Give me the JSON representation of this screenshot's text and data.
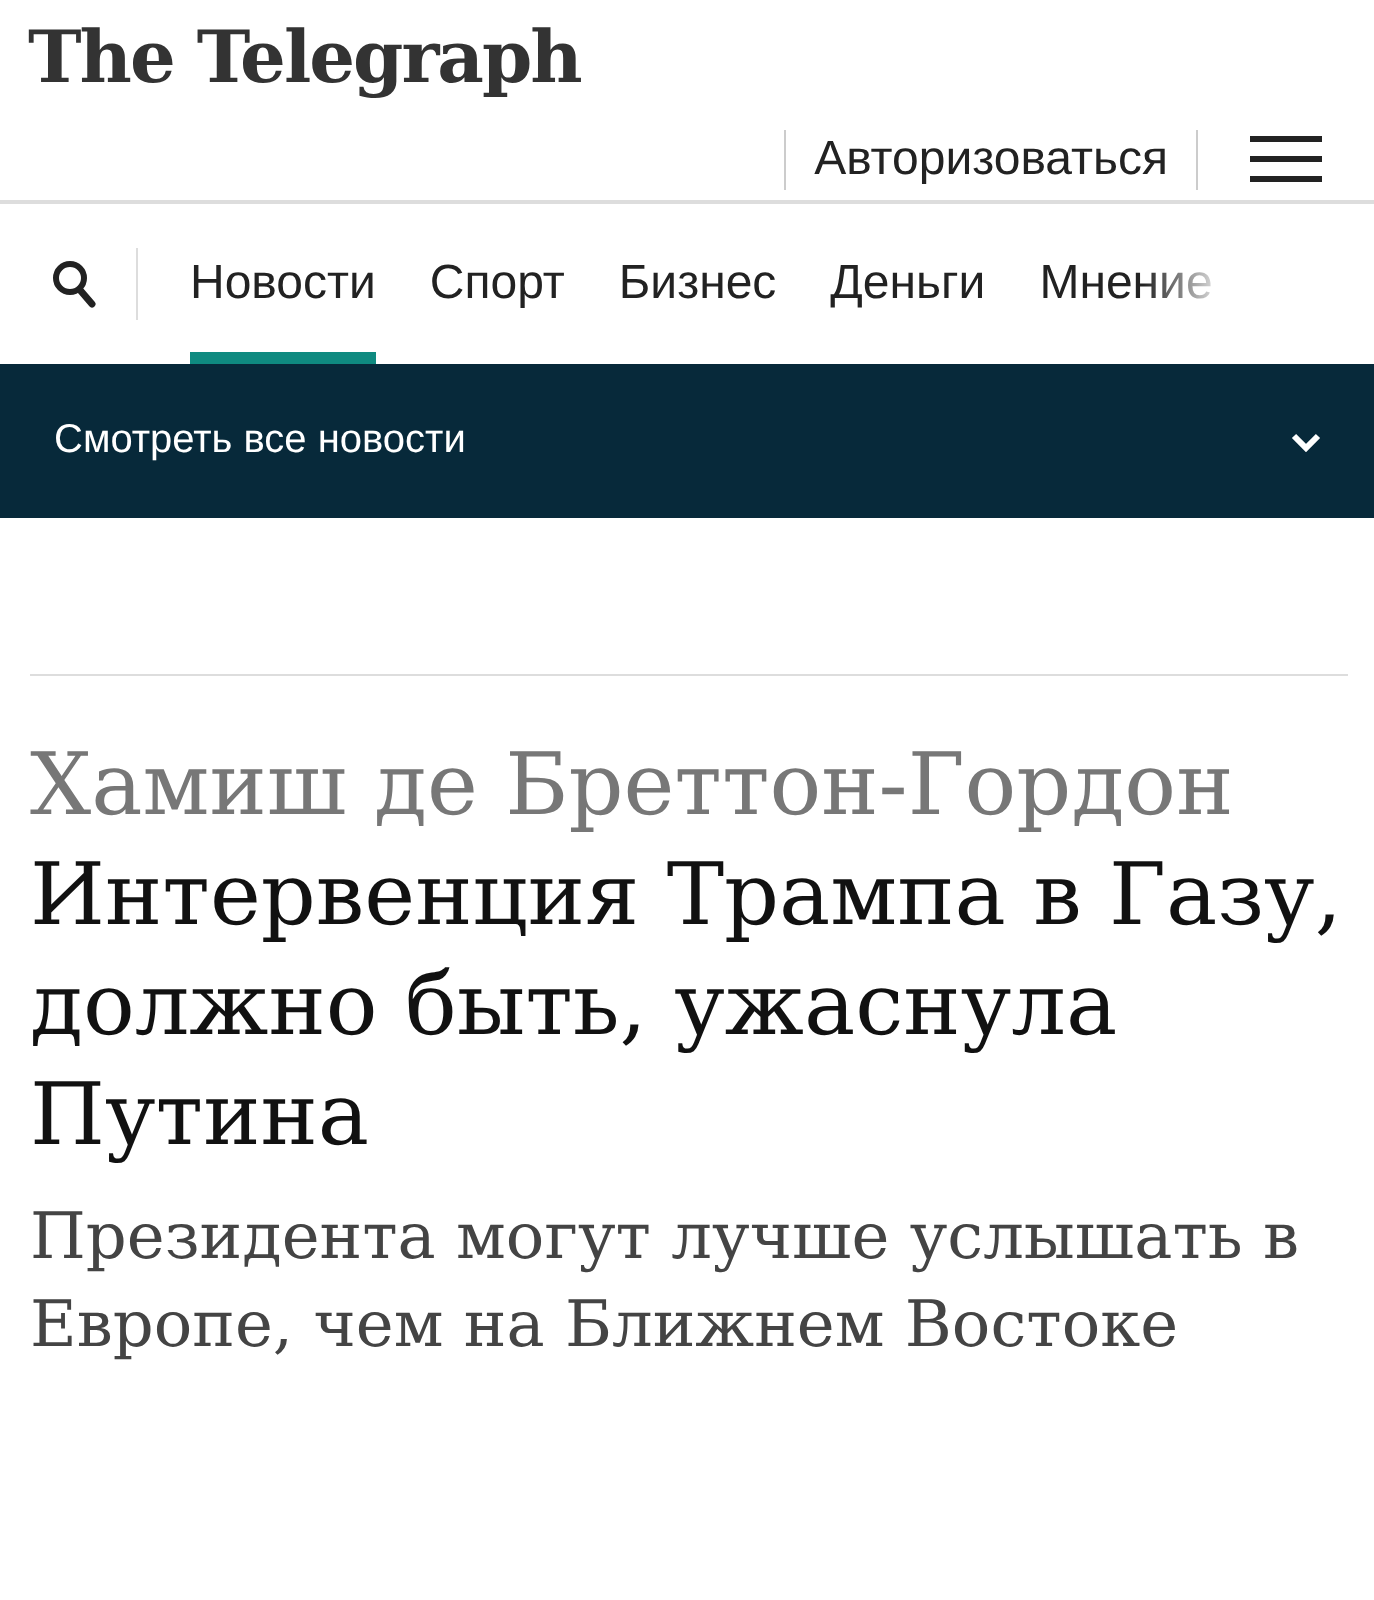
{
  "logo": "The Telegraph",
  "header": {
    "login": "Авторизоваться"
  },
  "nav": {
    "tabs": [
      {
        "label": "Новости",
        "selected": true
      },
      {
        "label": "Спорт",
        "selected": false
      },
      {
        "label": "Бизнес",
        "selected": false
      },
      {
        "label": "Деньги",
        "selected": false
      },
      {
        "label": "Мнение",
        "selected": false
      }
    ]
  },
  "news_bar": {
    "label": "Смотреть все новости",
    "expanded": false
  },
  "article": {
    "author": "Хамиш де Бреттон-Гордон",
    "title": "Интервенция Трампа в Газу, должно быть, ужаснула Путина",
    "subtitle": "Президента могут лучше услышать в Европе, чем на Ближнем Востоке"
  }
}
